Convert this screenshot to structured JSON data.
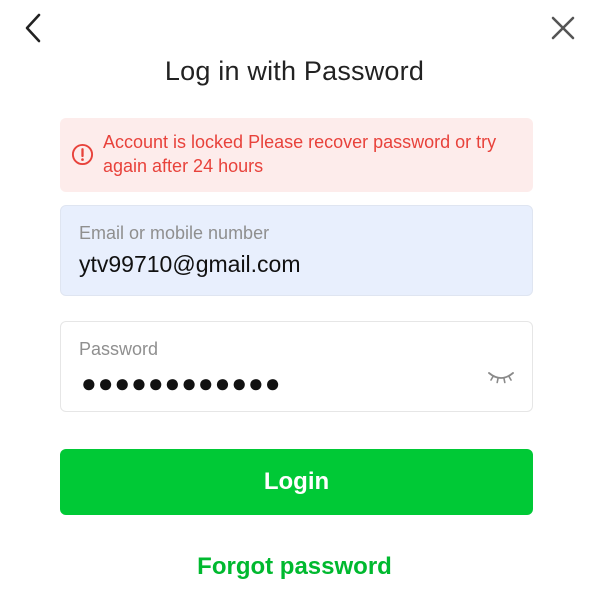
{
  "nav": {
    "back_icon": "chevron-left-icon",
    "close_icon": "close-icon"
  },
  "title": "Log in with Password",
  "alert": {
    "icon": "alert-circle-icon",
    "message": "Account is locked Please recover password or try again after 24 hours",
    "color": "#e8423b",
    "background": "#fdeceb"
  },
  "email_field": {
    "label": "Email or mobile number",
    "value": "ytv99710@gmail.com"
  },
  "password_field": {
    "label": "Password",
    "masked_value": "●●●●●●●●●●●●",
    "toggle_icon": "eye-closed-icon"
  },
  "login_button": {
    "label": "Login",
    "color": "#00c936"
  },
  "forgot_password": {
    "label": "Forgot password",
    "color": "#00b92f"
  }
}
